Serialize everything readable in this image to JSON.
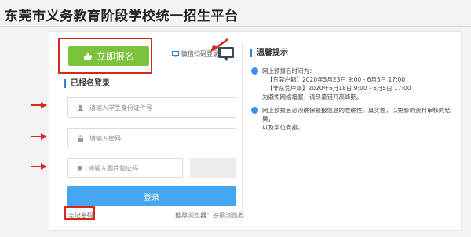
{
  "page": {
    "title": "东莞市义务教育阶段学校统一招生平台"
  },
  "actions": {
    "apply_label": "立即报名",
    "wechat_login_label": "微信扫码登录"
  },
  "login": {
    "heading": "已报名登录",
    "id_placeholder": "请输入学生身份证件号",
    "password_placeholder": "请输入密码",
    "captcha_placeholder": "请输入图片验证码",
    "submit_label": "登录",
    "forgot_label": "忘记密码",
    "browser_note": "推荐浏览器：谷歌浏览器"
  },
  "tips": {
    "heading": "温馨提示",
    "items": [
      {
        "lines": [
          "网上预报名时间为：",
          "【东莞户籍】2020年5月23日 9:00 - 6月5日 17:00",
          "【非东莞户籍】2020年6月18日 9:00 - 6月5日 17:00",
          "为避免网络堵塞，请尽量错开高峰期。"
        ]
      },
      {
        "lines": [
          "网上预报名必须确保报报信息的准确性、真实性，以免影响资料审核的结果，",
          "以及学位安排。"
        ]
      }
    ]
  },
  "colors": {
    "apply_green": "#7cc33d",
    "login_blue": "#44a6f0",
    "highlight_red": "#d8271c",
    "accent_blue": "#2e7fd6"
  }
}
